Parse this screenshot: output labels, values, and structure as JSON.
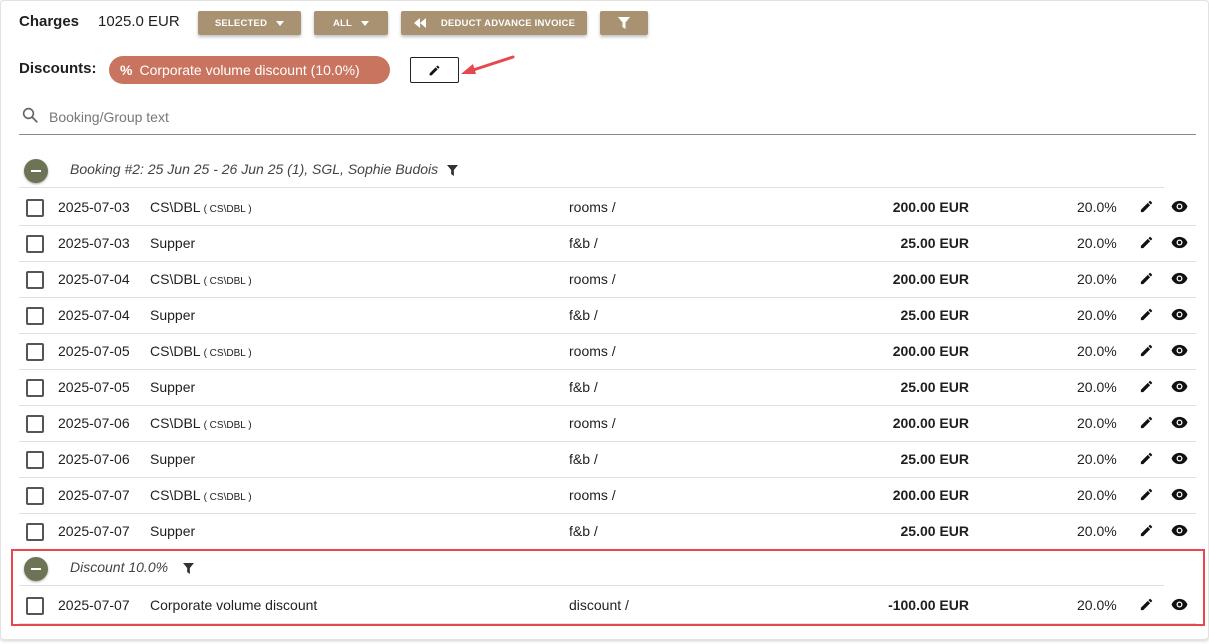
{
  "header": {
    "charges_label": "Charges",
    "charges_amount": "1025.0 EUR",
    "buttons": {
      "selected": "SELECTED",
      "all": "ALL",
      "deduct": "DEDUCT ADVANCE INVOICE"
    }
  },
  "discounts": {
    "label": "Discounts:",
    "chip_label": "Corporate volume discount (10.0%)",
    "chip_icon": "percent-icon"
  },
  "search": {
    "placeholder": "Booking/Group text",
    "value": ""
  },
  "groups": [
    {
      "title": "Booking #2: 25 Jun 25 - 26 Jun 25 (1), SGL, Sophie Budois",
      "rows": [
        {
          "date": "2025-07-03",
          "name": "CS\\DBL",
          "code": "( CS\\DBL )",
          "category": "rooms /",
          "amount": "200.00 EUR",
          "vat": "20.0%"
        },
        {
          "date": "2025-07-03",
          "name": "Supper",
          "code": "",
          "category": "f&b /",
          "amount": "25.00 EUR",
          "vat": "20.0%"
        },
        {
          "date": "2025-07-04",
          "name": "CS\\DBL",
          "code": "( CS\\DBL )",
          "category": "rooms /",
          "amount": "200.00 EUR",
          "vat": "20.0%"
        },
        {
          "date": "2025-07-04",
          "name": "Supper",
          "code": "",
          "category": "f&b /",
          "amount": "25.00 EUR",
          "vat": "20.0%"
        },
        {
          "date": "2025-07-05",
          "name": "CS\\DBL",
          "code": "( CS\\DBL )",
          "category": "rooms /",
          "amount": "200.00 EUR",
          "vat": "20.0%"
        },
        {
          "date": "2025-07-05",
          "name": "Supper",
          "code": "",
          "category": "f&b /",
          "amount": "25.00 EUR",
          "vat": "20.0%"
        },
        {
          "date": "2025-07-06",
          "name": "CS\\DBL",
          "code": "( CS\\DBL )",
          "category": "rooms /",
          "amount": "200.00 EUR",
          "vat": "20.0%"
        },
        {
          "date": "2025-07-06",
          "name": "Supper",
          "code": "",
          "category": "f&b /",
          "amount": "25.00 EUR",
          "vat": "20.0%"
        },
        {
          "date": "2025-07-07",
          "name": "CS\\DBL",
          "code": "( CS\\DBL )",
          "category": "rooms /",
          "amount": "200.00 EUR",
          "vat": "20.0%"
        },
        {
          "date": "2025-07-07",
          "name": "Supper",
          "code": "",
          "category": "f&b /",
          "amount": "25.00 EUR",
          "vat": "20.0%"
        }
      ]
    },
    {
      "title": "Discount 10.0%",
      "rows": [
        {
          "date": "2025-07-07",
          "name": "Corporate volume discount",
          "code": "",
          "category": "discount /",
          "amount": "-100.00 EUR",
          "vat": "20.0%"
        }
      ]
    }
  ],
  "colors": {
    "button_bg": "#a89272",
    "chip_bg": "#c8745e",
    "collapse_bg": "#6d7355",
    "annotation": "#e5484d"
  }
}
